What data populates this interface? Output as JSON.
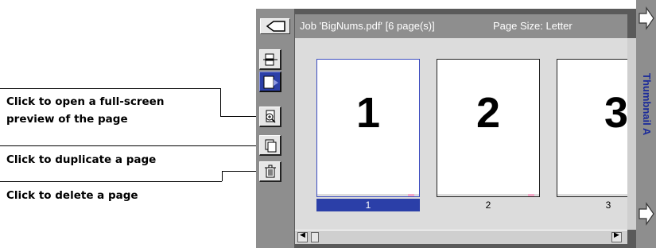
{
  "callouts": [
    {
      "line1": "Click to open a full-screen",
      "line2": "preview of the page"
    },
    {
      "line1": "Click to duplicate a page"
    },
    {
      "line1": "Click to delete a page"
    }
  ],
  "titlebar": {
    "job": "Job 'BigNums.pdf'  [6 page(s)]",
    "page_size": "Page Size: Letter"
  },
  "pages": [
    {
      "number": "1",
      "caption": "1",
      "selected": true
    },
    {
      "number": "2",
      "caption": "2",
      "selected": false
    },
    {
      "number": "3",
      "caption": "3",
      "selected": false
    }
  ],
  "side_panel": {
    "label": "Thumbnail A"
  },
  "tools": [
    {
      "icon": "pages-split-icon"
    },
    {
      "icon": "move-page-icon",
      "active": true
    },
    {
      "icon": "preview-zoom-icon"
    },
    {
      "icon": "duplicate-page-icon"
    },
    {
      "icon": "trash-icon"
    }
  ],
  "colors": {
    "accent": "#2b3fa8",
    "chrome": "#8e8e8e"
  }
}
